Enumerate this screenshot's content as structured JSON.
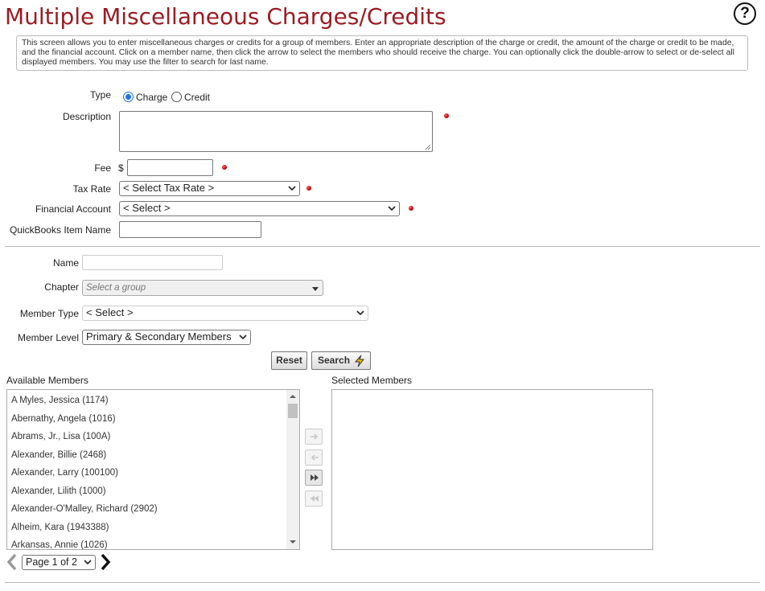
{
  "page": {
    "title": "Multiple Miscellaneous Charges/Credits",
    "help_icon": "question-circle-icon",
    "intro": "This screen allows you to enter miscellaneous charges or credits for a group of members. Enter an appropriate description of the charge or credit, the amount of the charge or credit to be made, and the financial account. Click on a member name, then click the arrow to select the members who should receive the charge. You can optionally click the double-arrow to select or de-select all displayed members. You may use the filter to search for last name."
  },
  "form": {
    "type_label": "Type",
    "type_options": [
      "Charge",
      "Credit"
    ],
    "type_selected": "Charge",
    "description_label": "Description",
    "description_value": "",
    "fee_label": "Fee",
    "fee_currency": "$",
    "fee_value": "",
    "tax_rate_label": "Tax Rate",
    "tax_rate_value": "< Select Tax Rate >",
    "financial_account_label": "Financial Account",
    "financial_account_value": "< Select >",
    "quickbooks_label": "QuickBooks Item Name",
    "quickbooks_value": "",
    "required_color": "#cc0000"
  },
  "filters": {
    "name_label": "Name",
    "name_value": "",
    "chapter_label": "Chapter",
    "chapter_placeholder": "Select a group",
    "member_type_label": "Member Type",
    "member_type_value": "< Select >",
    "member_level_label": "Member Level",
    "member_level_value": "Primary & Secondary Members",
    "reset_label": "Reset",
    "search_label": "Search",
    "search_icon": "lightning-bolt-icon"
  },
  "members": {
    "available_label": "Available Members",
    "selected_label": "Selected Members",
    "available": [
      "A Myles, Jessica (1174)",
      "Abernathy, Angela (1016)",
      "Abrams, Jr., Lisa (100A)",
      "Alexander, Billie (2468)",
      "Alexander, Larry (100100)",
      "Alexander, Lilith (1000)",
      "Alexander-O'Malley, Richard (2902)",
      "Alheim, Kara (1943388)",
      "Arkansas, Annie (1026)"
    ],
    "selected": [],
    "page_value": "Page 1 of 2"
  },
  "colors": {
    "title": "#9b1c22",
    "radio_accent": "#1a73e8",
    "bolt": "#f2c200"
  }
}
